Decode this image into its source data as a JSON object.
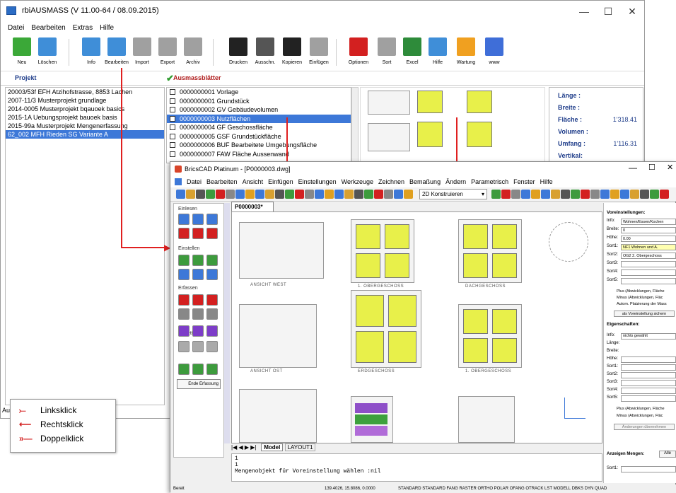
{
  "main_window": {
    "title": "rbiAUSMASS (V 11.00-64 / 08.09.2015)",
    "menu": [
      "Datei",
      "Bearbeiten",
      "Extras",
      "Hilfe"
    ],
    "toolbar": [
      {
        "label": "Neu",
        "icon": "new-icon",
        "color": "#3ba838"
      },
      {
        "label": "Löschen",
        "icon": "delete-icon",
        "color": "#3f8ed8"
      },
      {
        "label": "Info",
        "icon": "info-icon",
        "color": "#3f8ed8"
      },
      {
        "label": "Bearbeiten",
        "icon": "edit-icon",
        "color": "#3f8ed8"
      },
      {
        "label": "Import",
        "icon": "import-icon",
        "color": "#a0a0a0"
      },
      {
        "label": "Export",
        "icon": "export-icon",
        "color": "#a0a0a0"
      },
      {
        "label": "Archiv",
        "icon": "archive-icon",
        "color": "#a0a0a0"
      },
      {
        "label": "Drucken",
        "icon": "print-icon",
        "color": "#222222"
      },
      {
        "label": "Ausschn.",
        "icon": "cut-icon",
        "color": "#555555"
      },
      {
        "label": "Kopieren",
        "icon": "copy-icon",
        "color": "#222222"
      },
      {
        "label": "Einfügen",
        "icon": "paste-icon",
        "color": "#a0a0a0"
      },
      {
        "label": "Optionen",
        "icon": "options-icon",
        "color": "#d32020"
      },
      {
        "label": "Sort",
        "icon": "sort-icon",
        "color": "#a0a0a0"
      },
      {
        "label": "Excel",
        "icon": "excel-icon",
        "color": "#2e8b3a"
      },
      {
        "label": "Hilfe",
        "icon": "help-icon",
        "color": "#3f8ed8"
      },
      {
        "label": "Wartung",
        "icon": "maintenance-icon",
        "color": "#f0a020"
      },
      {
        "label": "www",
        "icon": "globe-icon",
        "color": "#3f6ed8"
      }
    ],
    "headers": {
      "projekt": "Projekt",
      "blaetter": "Ausmassblätter"
    },
    "projects": [
      "20003/53f EFH Atzihofstrasse, 8853 Lachen",
      "2007-11/3 Musterprojekt grundlage",
      "2014-0005 Musterprojekt bqauoek basics",
      "2015-1A  Uebungsprojekt bauoek basis",
      "2015-99a  Musterprojekt Mengenerfassung",
      "62_002   MFH Rieden SG Variante A"
    ],
    "selected_project": 5,
    "sheets": [
      "0000000001  Vorlage",
      "0000000001  Grundstück",
      "0000000002  GV Gebäudevolumen",
      "0000000003  Nutzflächen",
      "0000000004  GF Geschossfläche",
      "0000000005  GSF Grundstückfläche",
      "0000000006  BUF Bearbeitete Umgebungsfläche",
      "0000000007  FAW Fläche Aussenwand"
    ],
    "selected_sheet": 3,
    "info": [
      {
        "label": "Länge :",
        "value": ""
      },
      {
        "label": "Breite :",
        "value": ""
      },
      {
        "label": "Fläche :",
        "value": "1'318.41"
      },
      {
        "label": "Volumen :",
        "value": ""
      },
      {
        "label": "Umfang :",
        "value": "1'116.31"
      },
      {
        "label": "Vertikal:",
        "value": ""
      }
    ],
    "status_prefix": "Au"
  },
  "cad_window": {
    "title": "BricsCAD Platinum - [P0000003.dwg]",
    "menu": [
      "Datei",
      "Bearbeiten",
      "Ansicht",
      "Einfügen",
      "Einstellungen",
      "Werkzeuge",
      "Zeichnen",
      "Bemaßung",
      "Ändern",
      "Parametrisch",
      "Fenster",
      "Hilfe"
    ],
    "combo": "2D Konstruieren",
    "tab": "P0000003*",
    "left_panel_groups": [
      "Einlesen",
      "Einstellen",
      "Erfassen",
      "Tablett"
    ],
    "end_button": "Ende Erfassung",
    "layout_tabs": [
      "Model",
      "LAYOUT1"
    ],
    "command_lines": [
      "1",
      "1"
    ],
    "command_prompt": "Mengenobjekt für Voreinstellung wählen :nil",
    "status": {
      "left": "Bereit",
      "coords": "139.4026, 15.8086, 0.0000",
      "items": "STANDARD  STANDARD  FANG  RASTER  ORTHO  POLAR  OFANG  OTRACK  LST  MODELL  DBKS  DYN  QUAD"
    },
    "plan_captions": [
      "ANSICHT WEST",
      "1. OBERGESCHOSS",
      "DACHGESCHOSS",
      "ANSICHT OST",
      "ERDGESCHOSS",
      "1. OBERGESCHOSS"
    ],
    "right_panel": {
      "voreinstellungen": "Voreinstellungen:",
      "fields": [
        {
          "label": "Info:",
          "value": "Wohnen/Essen/Kochen"
        },
        {
          "label": "Breite:",
          "value": "0"
        },
        {
          "label": "Höhe:",
          "value": "0.00"
        },
        {
          "label": "Sort1:",
          "value": "NF1 Wohnen und A."
        },
        {
          "label": "Sort2:",
          "value": "OG2 2. Obergeschoss"
        },
        {
          "label": "Sort3:",
          "value": ""
        },
        {
          "label": "Sort4:",
          "value": ""
        },
        {
          "label": "Sort5:",
          "value": ""
        }
      ],
      "options": [
        "Plus (Abwicklungen, Fläche",
        "Minus (Abwicklungen, Fläc",
        "Autom. Platzierung der Mass"
      ],
      "save_btn": "als Voreinstellung sichern",
      "eigenschaften": "Eigenschaften:",
      "eig_info": "nichts gewählt",
      "eig_labels": [
        "Info:",
        "Länge:",
        "Breite:",
        "Höhe:",
        "Sort1:",
        "Sort2:",
        "Sort3:",
        "Sort4:",
        "Sort5:"
      ],
      "options2": [
        "Plus (Abwicklungen, Fläche",
        "Minus (Abwicklungen, Fläc"
      ],
      "apply_btn": "Änderungen übernehmen",
      "anzeigen": "Anzeigen Mengen:",
      "anzeigen_btn": "Alle",
      "sort1": "Sort1:"
    }
  },
  "legend": [
    {
      "arrow": "⤚",
      "text": "Linksklick"
    },
    {
      "arrow": "⟵",
      "text": "Rechtsklick"
    },
    {
      "arrow": "»—",
      "text": "Doppelklick"
    }
  ]
}
